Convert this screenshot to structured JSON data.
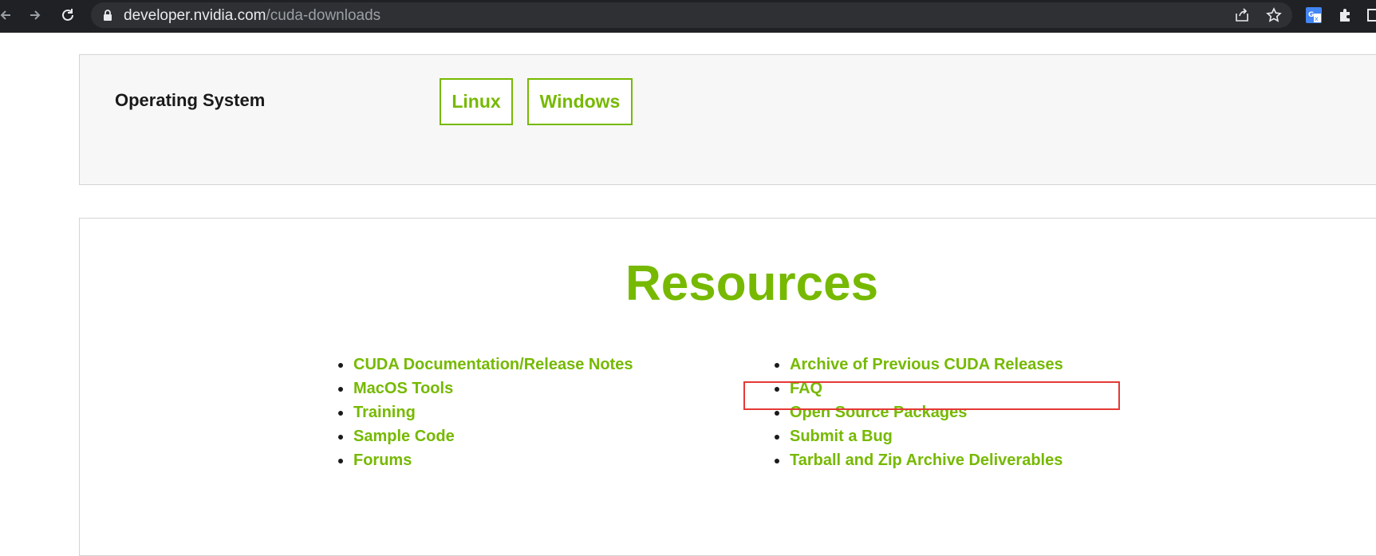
{
  "browser": {
    "url_host": "developer.nvidia.com",
    "url_path": "/cuda-downloads"
  },
  "os_selector": {
    "label": "Operating System",
    "options": [
      "Linux",
      "Windows"
    ]
  },
  "resources": {
    "title": "Resources",
    "left_links": [
      "CUDA Documentation/Release Notes",
      "MacOS Tools",
      "Training",
      "Sample Code",
      "Forums"
    ],
    "right_links": [
      "Archive of Previous CUDA Releases",
      "FAQ",
      "Open Source Packages",
      "Submit a Bug",
      "Tarball and Zip Archive Deliverables"
    ]
  },
  "colors": {
    "accent": "#76b900",
    "highlight": "#e53935",
    "browser_bar": "#202124"
  }
}
